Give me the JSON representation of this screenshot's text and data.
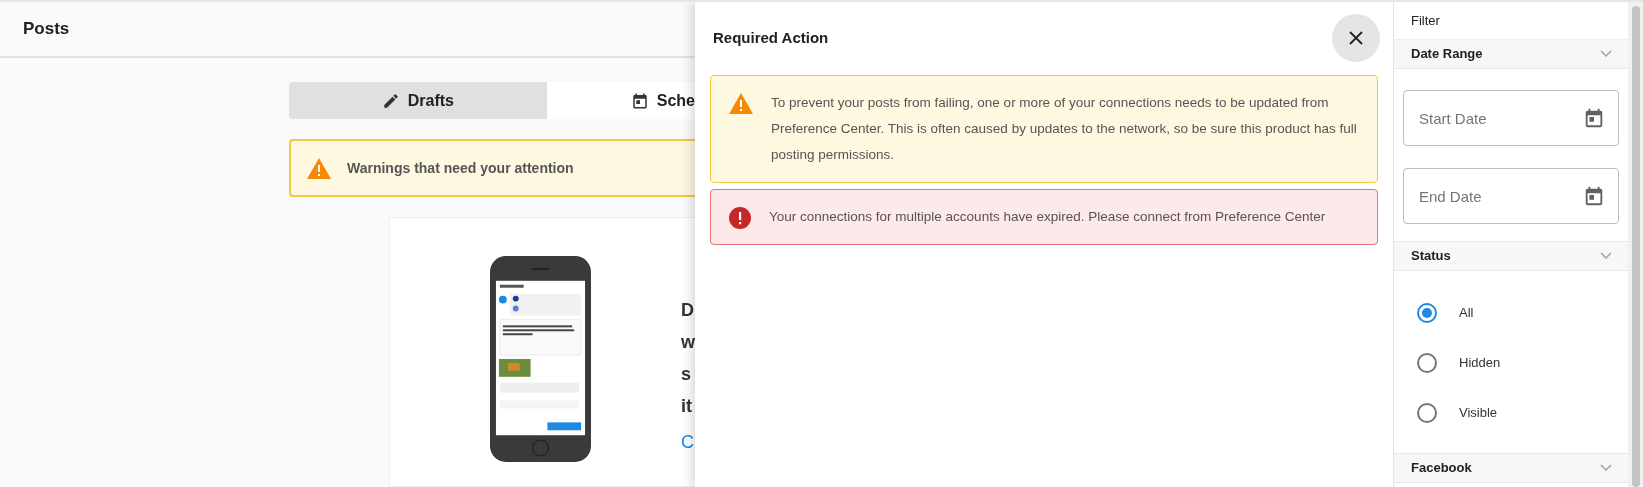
{
  "header": {
    "title": "Posts"
  },
  "tabs": [
    {
      "label": "Drafts",
      "selected": true
    },
    {
      "label": "Sche",
      "selected": false
    }
  ],
  "warning_banner": {
    "text": "Warnings that need your attention"
  },
  "empty_state": {
    "lines": [
      "D",
      "w",
      "s",
      "it"
    ],
    "link": "C"
  },
  "drawer": {
    "title": "Required Action",
    "alerts": [
      {
        "kind": "warning",
        "text": "To prevent your posts from failing, one or more of your connections needs to be updated from Preference Center. This is often caused by updates to the network, so be sure this product has full posting permissions."
      },
      {
        "kind": "error",
        "text": "Your connections for multiple accounts have expired. Please connect from Preference Center"
      }
    ]
  },
  "filter": {
    "title": "Filter",
    "sections": [
      {
        "kind": "dates",
        "title": "Date Range",
        "fields": [
          {
            "placeholder": "Start Date"
          },
          {
            "placeholder": "End Date"
          }
        ]
      },
      {
        "kind": "radios",
        "title": "Status",
        "options": [
          {
            "label": "All",
            "selected": true
          },
          {
            "label": "Hidden",
            "selected": false
          },
          {
            "label": "Visible",
            "selected": false
          }
        ]
      },
      {
        "kind": "collapsed",
        "title": "Facebook"
      }
    ]
  }
}
